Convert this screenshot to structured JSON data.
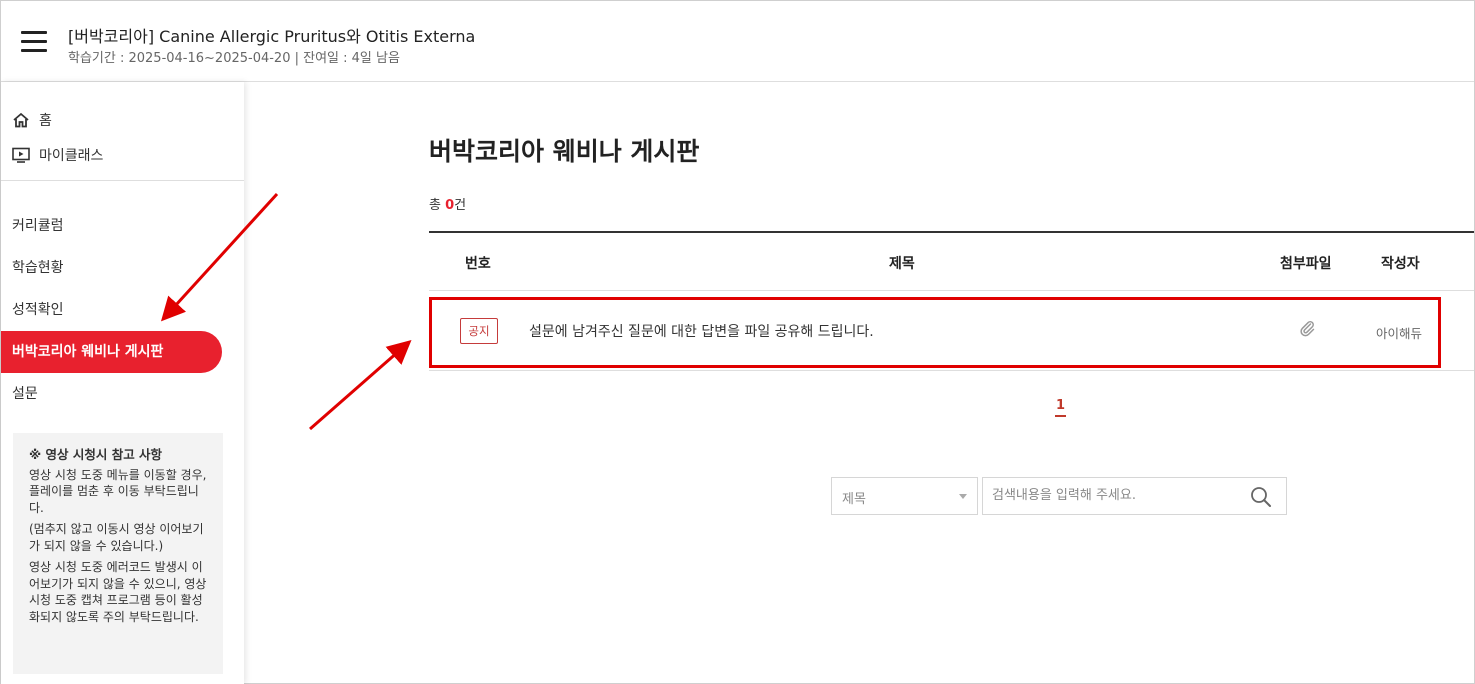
{
  "header": {
    "course_title": "[버박코리아] Canine Allergic Pruritus와 Otitis Externa",
    "course_period": "학습기간 : 2025-04-16~2025-04-20 | 잔여일 : 4일 남음"
  },
  "sidebar": {
    "home_label": "홈",
    "myclass_label": "마이클래스",
    "menu": [
      {
        "label": "커리큘럼"
      },
      {
        "label": "학습현황"
      },
      {
        "label": "성적확인"
      },
      {
        "label": "버박코리아 웨비나 게시판"
      },
      {
        "label": "설문"
      }
    ],
    "notice": {
      "title": "※ 영상 시청시 참고 사항",
      "p1": "영상 시청 도중 메뉴를 이동할 경우, 플레이를 멈춘 후 이동 부탁드립니다.",
      "p2": "(멈추지 않고 이동시 영상 이어보기가 되지 않을 수 있습니다.)",
      "p3": "영상 시청 도중 에러코드 발생시 이어보기가 되지 않을 수 있으니, 영상 시청 도중 캡쳐 프로그램 등이 활성화되지 않도록 주의 부탁드립니다."
    }
  },
  "board": {
    "title": "버박코리아 웨비나 게시판",
    "total_prefix": "총 ",
    "total_count": "0",
    "total_suffix": "건",
    "columns": {
      "no": "번호",
      "title": "제목",
      "attachment": "첨부파일",
      "author": "작성자"
    },
    "rows": [
      {
        "badge": "공지",
        "title": "설문에 남겨주신 질문에 대한 답변을 파일 공유해 드립니다.",
        "author": "아이해듀",
        "attachment_icon": "paperclip-icon"
      }
    ],
    "pagination": {
      "current": "1"
    },
    "search": {
      "field_selected": "제목",
      "placeholder": "검색내용을 입력해 주세요."
    }
  },
  "colors": {
    "accent": "#e8212e",
    "annotation": "#e00000"
  }
}
